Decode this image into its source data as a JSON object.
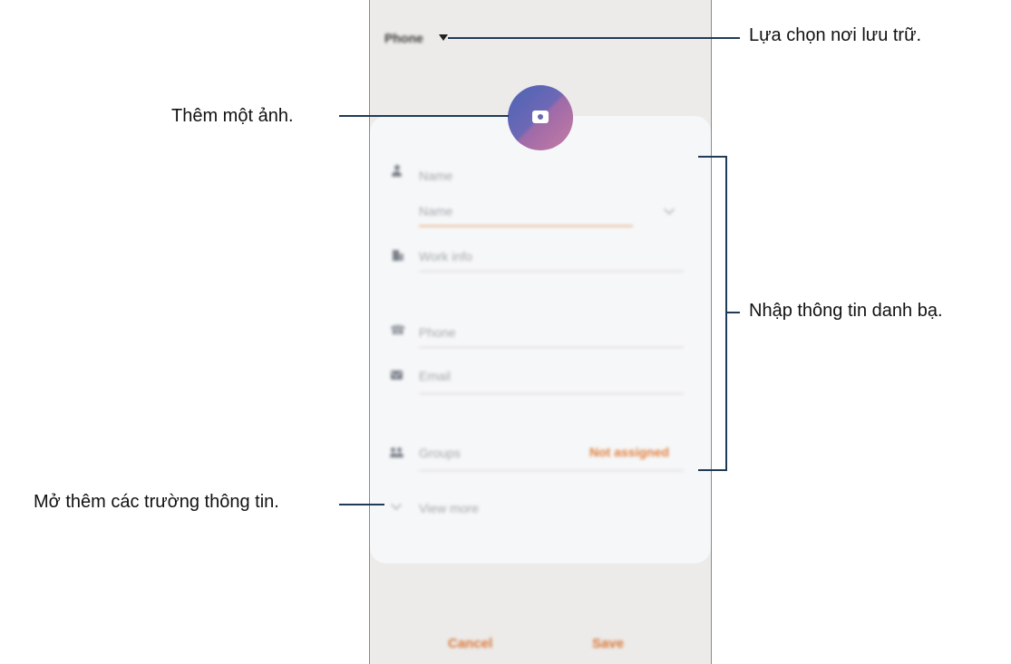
{
  "screen": {
    "storage_label": "Phone",
    "fields": {
      "name_header": "Name",
      "name_input_placeholder": "Name",
      "work_info_placeholder": "Work info",
      "phone_placeholder": "Phone",
      "email_placeholder": "Email",
      "groups_label": "Groups",
      "groups_value": "Not assigned"
    },
    "view_more_label": "View more",
    "buttons": {
      "cancel": "Cancel",
      "save": "Save"
    },
    "colors": {
      "accent": "#e07e3c",
      "avatar_start": "#4a64b3",
      "avatar_end": "#c57ca4"
    }
  },
  "annotations": {
    "storage": "Lựa chọn nơi lưu trữ.",
    "photo": "Thêm một ảnh.",
    "contact_info": "Nhập thông tin danh bạ.",
    "more_fields": "Mở thêm các trường thông tin."
  }
}
